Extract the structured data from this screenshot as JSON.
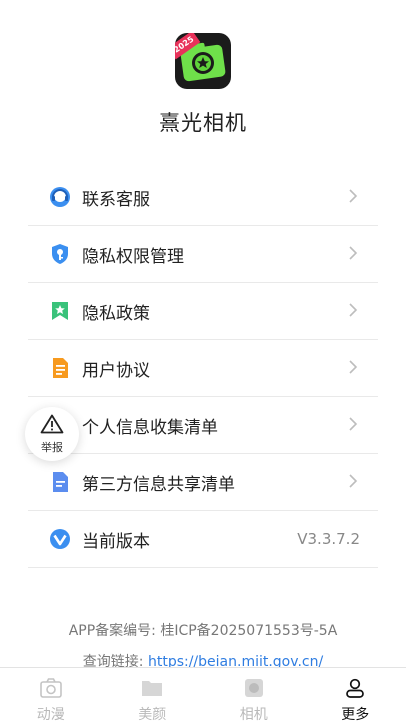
{
  "app": {
    "name": "熹光相机",
    "logo_badge": "2025"
  },
  "menu": {
    "items": [
      {
        "label": "联系客服",
        "icon": "headset-icon"
      },
      {
        "label": "隐私权限管理",
        "icon": "shield-key-icon"
      },
      {
        "label": "隐私政策",
        "icon": "bookmark-star-icon"
      },
      {
        "label": "用户协议",
        "icon": "document-icon"
      },
      {
        "label": "个人信息收集清单",
        "icon": "person-card-icon"
      },
      {
        "label": "第三方信息共享清单",
        "icon": "share-document-icon"
      },
      {
        "label": "当前版本",
        "icon": "version-logo-icon",
        "value": "V3.3.7.2"
      }
    ]
  },
  "report": {
    "label": "举报",
    "icon": "warning-icon"
  },
  "footer": {
    "record_label": "APP备案编号: 桂ICP备2025071553号-5A",
    "query_label": "查询链接: ",
    "query_link": "https://beian.miit.gov.cn/"
  },
  "tabs": [
    {
      "label": "动漫",
      "icon": "camera-icon",
      "active": false
    },
    {
      "label": "美颜",
      "icon": "folder-icon",
      "active": false
    },
    {
      "label": "相机",
      "icon": "camera-square-icon",
      "active": false
    },
    {
      "label": "更多",
      "icon": "person-icon",
      "active": true
    }
  ],
  "colors": {
    "accent_blue": "#2f7de1",
    "brand_green": "#5fd43a",
    "badge_red": "#e8325a"
  }
}
